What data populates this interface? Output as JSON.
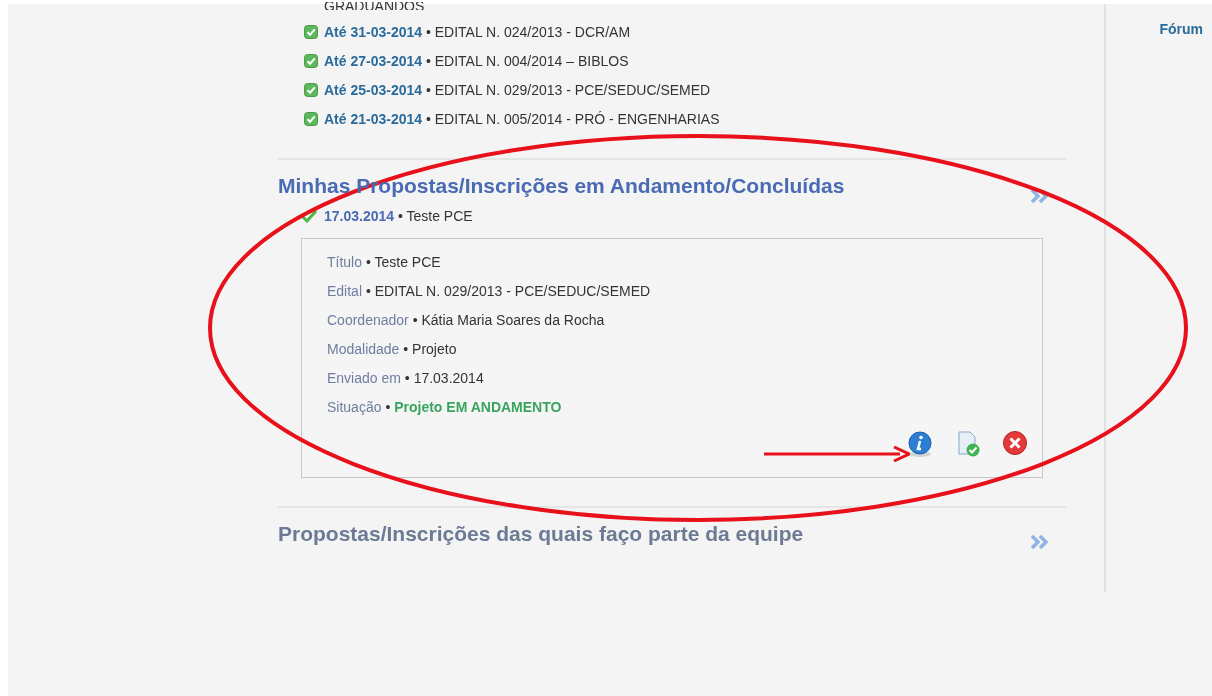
{
  "top_list": {
    "cut_item": "GRADUANDOS",
    "separator": "•",
    "items": [
      {
        "deadline": "Até 31-03-2014",
        "label": "EDITAL N. 024/2013 - DCR/AM"
      },
      {
        "deadline": "Até 27-03-2014",
        "label": "EDITAL N. 004/2014 – BIBLOS"
      },
      {
        "deadline": "Até 25-03-2014",
        "label": "EDITAL N. 029/2013 - PCE/SEDUC/SEMED"
      },
      {
        "deadline": "Até 21-03-2014",
        "label": "EDITAL N. 005/2014 - PRÓ - ENGENHARIAS"
      }
    ]
  },
  "sections": [
    {
      "title": "Minhas Propostas/Inscrições em Andamento/Concluídas",
      "expanded": true,
      "entries": [
        {
          "date": "17.03.2014",
          "separator": "•",
          "title": "Teste PCE",
          "details": [
            {
              "label": "Título",
              "separator": "•",
              "value": "Teste PCE",
              "kind": "plain"
            },
            {
              "label": "Edital",
              "separator": "•",
              "value": "EDITAL N. 029/2013 - PCE/SEDUC/SEMED",
              "kind": "plain"
            },
            {
              "label": "Coordenador",
              "separator": "•",
              "value": "Kátia Maria Soares da Rocha",
              "kind": "plain"
            },
            {
              "label": "Modalidade",
              "separator": "•",
              "value": "Projeto",
              "kind": "plain"
            },
            {
              "label": "Enviado em",
              "separator": "•",
              "value": "17.03.2014",
              "kind": "plain"
            },
            {
              "label": "Situação",
              "separator": "•",
              "value": "Projeto EM ANDAMENTO",
              "kind": "status"
            }
          ]
        }
      ]
    },
    {
      "title": "Propostas/Inscrições das quais faço parte da equipe",
      "expanded": false
    }
  ],
  "sidebar": {
    "link": "Fórum"
  }
}
